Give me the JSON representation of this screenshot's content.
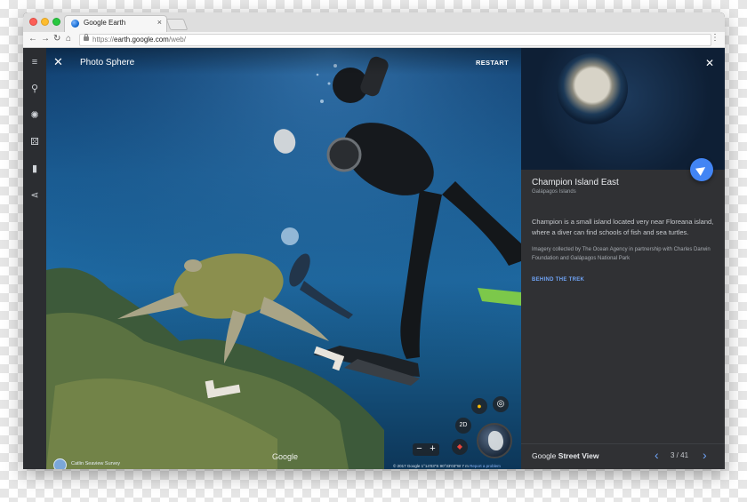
{
  "browser": {
    "tab_title": "Google Earth",
    "tab_close": "×",
    "url_proto": "https://",
    "url_host": "earth.google.com",
    "url_path": "/web/",
    "nav": {
      "back": "←",
      "forward": "→",
      "reload": "↻",
      "home": "⌂",
      "menu": "⋮"
    }
  },
  "rail": {
    "items": [
      {
        "icon": "≡",
        "name": "menu-icon"
      },
      {
        "icon": "⚲",
        "name": "search-icon"
      },
      {
        "icon": "✺",
        "name": "voyager-icon"
      },
      {
        "icon": "⚄",
        "name": "feeling-lucky-icon"
      },
      {
        "icon": "▮",
        "name": "bookmark-icon"
      },
      {
        "icon": "⋖",
        "name": "share-icon"
      }
    ]
  },
  "photo_sphere": {
    "close": "✕",
    "title": "Photo Sphere",
    "restart": "RESTART",
    "credit_name": "Catlin Seaview Survey",
    "watermark": "Google",
    "footer": "© 2017 Google    1°14'03\"S 90°33'03\"W    7 m",
    "report": "Report a problem",
    "controls": {
      "mode_2d": "2D",
      "zoom_out": "−",
      "zoom_in": "+",
      "pegman": "●",
      "location": "◎",
      "compass": "◆"
    }
  },
  "panel": {
    "close": "✕",
    "title": "Champion Island East",
    "subtitle": "Galápagos Islands",
    "description": "Champion is a small island located very near Floreana island, where a diver can find schools of fish and sea turtles.",
    "imagery": "Imagery collected by The Ocean Agency in partnership with Charles Darwin Foundation and Galápagos National Park",
    "link": "BEHIND THE TREK",
    "footer_brand_light": "Google",
    "footer_brand_bold": "Street View",
    "pager_prev": "‹",
    "pager_next": "›",
    "pager_count": "3 / 41"
  },
  "colors": {
    "accent": "#4285f4",
    "panel_bg": "#303134",
    "rail_bg": "#2b2d31"
  }
}
